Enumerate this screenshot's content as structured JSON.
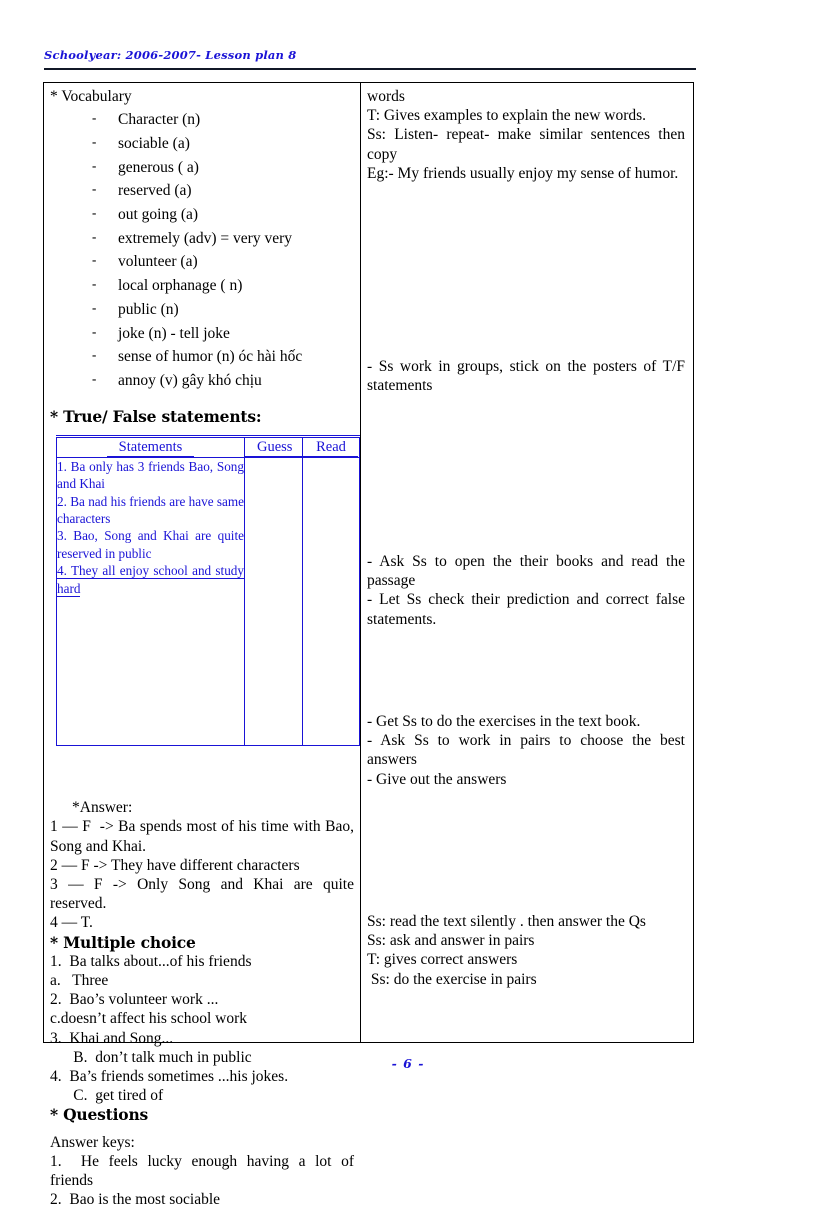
{
  "header": {
    "text": "Schoolyear: 2006-2007- Lesson plan 8"
  },
  "footer": {
    "page_number": "- 6 -"
  },
  "colors": {
    "ink": "#000000",
    "accent_blue": "#1a13d6"
  },
  "left_column": {
    "vocabulary_heading": "* Vocabulary",
    "vocabulary_items": [
      "Character (n)",
      "sociable (a)",
      "generous  ( a)",
      "reserved (a)",
      "out going (a)",
      "extremely (adv) = very very",
      "volunteer (a)",
      "local orphanage ( n)",
      "public (n)",
      "joke (n)  - tell joke",
      "sense of humor (n) óc hài hốc",
      "annoy (v) gây khó chịu"
    ],
    "tf_heading": "* True/ False statements:",
    "tf_table": {
      "columns": [
        "Statements",
        "Guess",
        "Read"
      ],
      "statements": [
        "1. Ba only has 3 friends Bao, Song and Khai",
        "2. Ba nad his friends are have same characters",
        "3. Bao, Song and Khai are quite reserved in public",
        "4. They all enjoy school and study hard"
      ],
      "guess_values": [
        "",
        "",
        "",
        ""
      ],
      "read_values": [
        "",
        "",
        "",
        ""
      ]
    },
    "answer_heading": "*Answer:",
    "answer_lines": [
      "1 — F  -> Ba spends most of his time with Bao, Song and Khai.",
      "2 — F -> They have different characters",
      "3 — F -> Only Song and Khai are quite reserved.",
      "4 — T."
    ],
    "multiple_choice_heading": "* Multiple choice",
    "multiple_choice_lines": [
      "1.  Ba talks about...of his friends",
      "a.   Three",
      "2.  Bao’s volunteer work ...",
      "c.doesn’t affect his school work",
      "3.  Khai and Song...",
      "      B.  don’t talk much in public",
      "4.  Ba’s friends sometimes ...his jokes.",
      "      C.  get tired of"
    ],
    "questions_heading": "* Questions",
    "answer_keys_heading": "Answer keys:",
    "answer_keys": [
      "1.  He feels lucky enough having a lot of     friends",
      "2.  Bao is the most sociable"
    ]
  },
  "right_column": {
    "block_1": "words\nT: Gives examples to explain the new words.\nSs: Listen- repeat- make similar sentences then copy\nEg:- My friends usually enjoy my sense of humor.",
    "block_2": "- Ss work in groups, stick on the posters of T/F statements",
    "block_3": "- Ask Ss to open the their books and read the passage\n- Let Ss check their prediction and correct false statements.",
    "block_4": "- Get Ss to do the exercises in the text book.\n- Ask Ss to work in pairs to choose the best answers\n- Give out the answers",
    "block_5": "Ss: read the text silently . then answer the Qs\nSs: ask and answer in pairs\nT: gives correct answers\n Ss: do the exercise in pairs"
  }
}
